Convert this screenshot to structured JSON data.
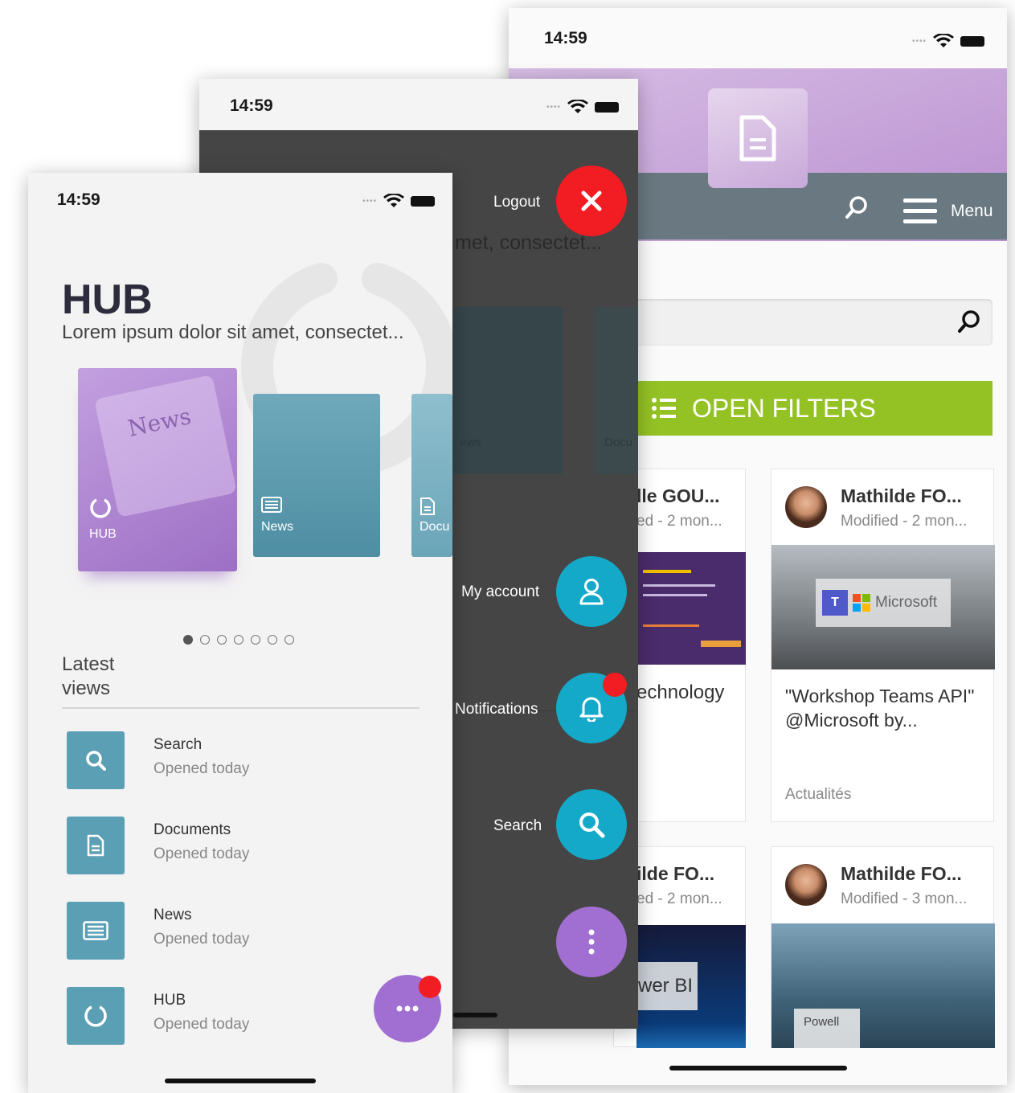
{
  "back_phone": {
    "time": "14:59",
    "menu_label": "Menu",
    "open_filters": "OPEN FILTERS",
    "cards": [
      {
        "name": "lle GOU...",
        "modified": "ed - 2 mon...",
        "title": "echnology"
      },
      {
        "name": "Mathilde FO...",
        "modified": "Modified - 2 mon...",
        "title": "\"Workshop Teams API\" @Microsoft by...",
        "category": "Actualités",
        "image_text": "Microsoft"
      },
      {
        "name": "ilde FO...",
        "modified": "ed - 2 mon...",
        "image_text": "wer BI"
      },
      {
        "name": "Mathilde FO...",
        "modified": "Modified - 3 mon...",
        "image_text": "Powell"
      }
    ]
  },
  "menu_phone": {
    "time": "14:59",
    "logout_label": "Logout",
    "bg_subtitle": "met, consectet...",
    "bg_slide_labels": [
      "ews",
      "Docu"
    ],
    "my_account_label": "My account",
    "notifications_label": "Notifications",
    "search_label": "Search"
  },
  "front_phone": {
    "time": "14:59",
    "title": "HUB",
    "subtitle": "Lorem ipsum dolor sit amet, consectet...",
    "slides": [
      {
        "label": "HUB",
        "image_text": "News"
      },
      {
        "label": "News"
      },
      {
        "label": "Docu"
      }
    ],
    "latest_views_title": "Latest\nviews",
    "latest_views": [
      {
        "title": "Search",
        "subtitle": "Opened today",
        "icon": "search-icon"
      },
      {
        "title": "Documents",
        "subtitle": "Opened today",
        "icon": "document-icon"
      },
      {
        "title": "News",
        "subtitle": "Opened today",
        "icon": "news-icon"
      },
      {
        "title": "HUB",
        "subtitle": "Opened today",
        "icon": "hub-icon"
      }
    ]
  },
  "colors": {
    "hub_purple": "#b58bd6",
    "teal": "#5a9fb4",
    "fab_cyan": "#15a9c9",
    "filters_green": "#94c225",
    "close_red": "#f21c23"
  }
}
